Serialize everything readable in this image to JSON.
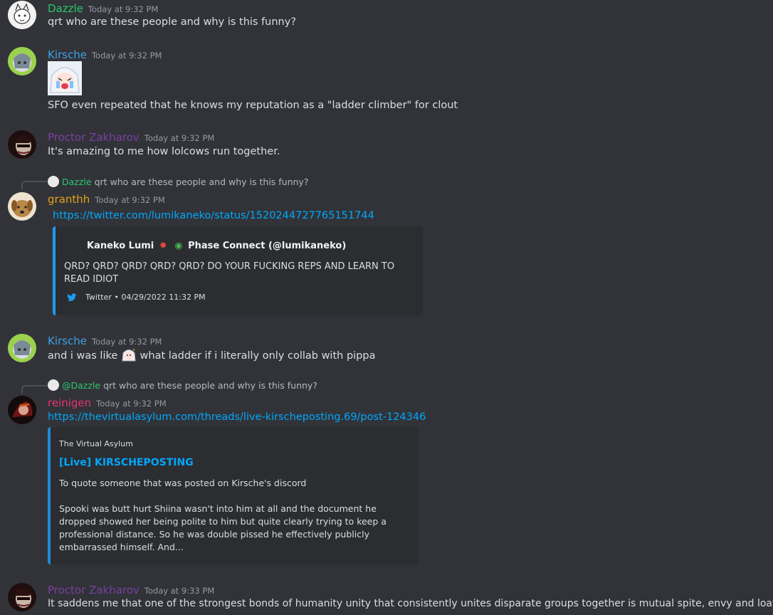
{
  "colors": {
    "background": "#313338",
    "link": "#00a8fc",
    "timestamp": "#949ba4",
    "dazzle": "#2dc770",
    "kirsche": "#3ea2e8",
    "proctor": "#7b3fa0",
    "granthh": "#e6a11a",
    "reinigen": "#e8326b",
    "twitter_bar": "#1d9bf0"
  },
  "messages": [
    {
      "author": "Dazzle",
      "time": "Today at 9:32 PM",
      "text": "qrt who are these people and why is this funny?"
    },
    {
      "author": "Kirsche",
      "time": "Today at 9:32 PM",
      "text": "SFO even repeated that he knows my reputation as a \"ladder climber\" for clout"
    },
    {
      "author": "Proctor Zakharov",
      "time": "Today at 9:32 PM",
      "text": "It's amazing to me how lolcows run together."
    },
    {
      "author": "granthh",
      "time": "Today at 9:32 PM",
      "reply": {
        "author": "Dazzle",
        "text": "qrt who are these people and why is this funny?"
      },
      "link": "https://twitter.com/lumikaneko/status/1520244727765151744",
      "embed": {
        "author": "Kaneko Lumi",
        "author_suffix": "Phase Connect (@lumikaneko)",
        "description": "QRD? QRD? QRD? QRD? QRD? DO YOUR FUCKING REPS AND LEARN TO READ IDIOT",
        "footer": "Twitter • 04/29/2022 11:32 PM"
      }
    },
    {
      "author": "Kirsche",
      "time": "Today at 9:32 PM",
      "text_before": "and i was like",
      "text_after": "what ladder if i literally only collab with pippa"
    },
    {
      "author": "reinigen",
      "time": "Today at 9:32 PM",
      "reply": {
        "author": "@Dazzle",
        "text": "qrt who are these people and why is this funny?"
      },
      "link": "https://thevirtualasylum.com/threads/live-kirscheposting.69/post-124346",
      "embed": {
        "provider": "The Virtual Asylum",
        "title": "[Live] KIRSCHEPOSTING",
        "line1": "To quote someone that was posted on Kirsche's discord",
        "body": "Spooki was butt hurt Shiina wasn't into him at all and the document he dropped showed her being polite to him but quite clearly trying to keep a professional distance. So he was double pissed he effectively publicly embarrassed himself. And..."
      }
    },
    {
      "author": "Proctor Zakharov",
      "time": "Today at 9:33 PM",
      "text": "It saddens me that one of the strongest bonds of humanity unity that consistently unites disparate groups together is mutual spite, envy and loathing."
    }
  ],
  "icons": {
    "avatar_dazzle": "white-cartoon-cat-avatar",
    "avatar_kirsche": "green-haired-character-avatar",
    "avatar_proctor": "dark-red-masked-avatar",
    "avatar_granthh": "brown-dog-avatar",
    "avatar_reinigen": "dark-red-character-avatar",
    "twitter": "twitter-bird-icon",
    "sticker": "anime-girl-crying-sticker"
  }
}
